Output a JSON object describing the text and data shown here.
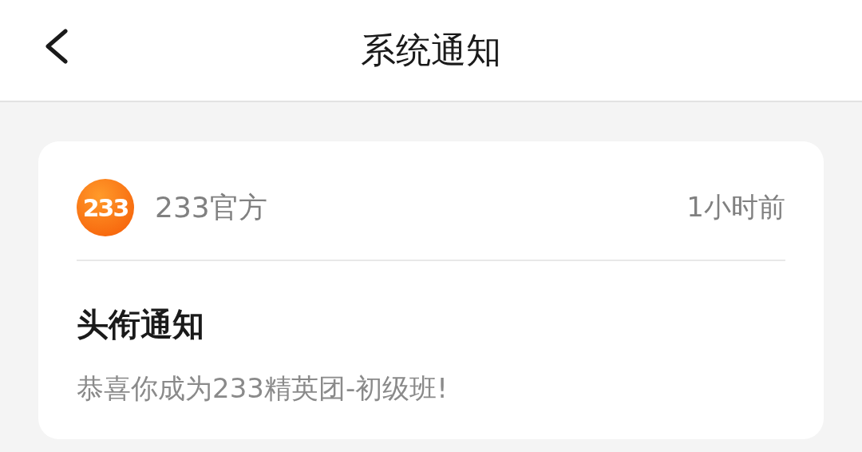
{
  "header": {
    "title": "系统通知"
  },
  "notifications": [
    {
      "sender": {
        "logo_text": "233",
        "name": "233官方"
      },
      "time": "1小时前",
      "title": "头衔通知",
      "message": "恭喜你成为233精英团-初级班!"
    }
  ]
}
